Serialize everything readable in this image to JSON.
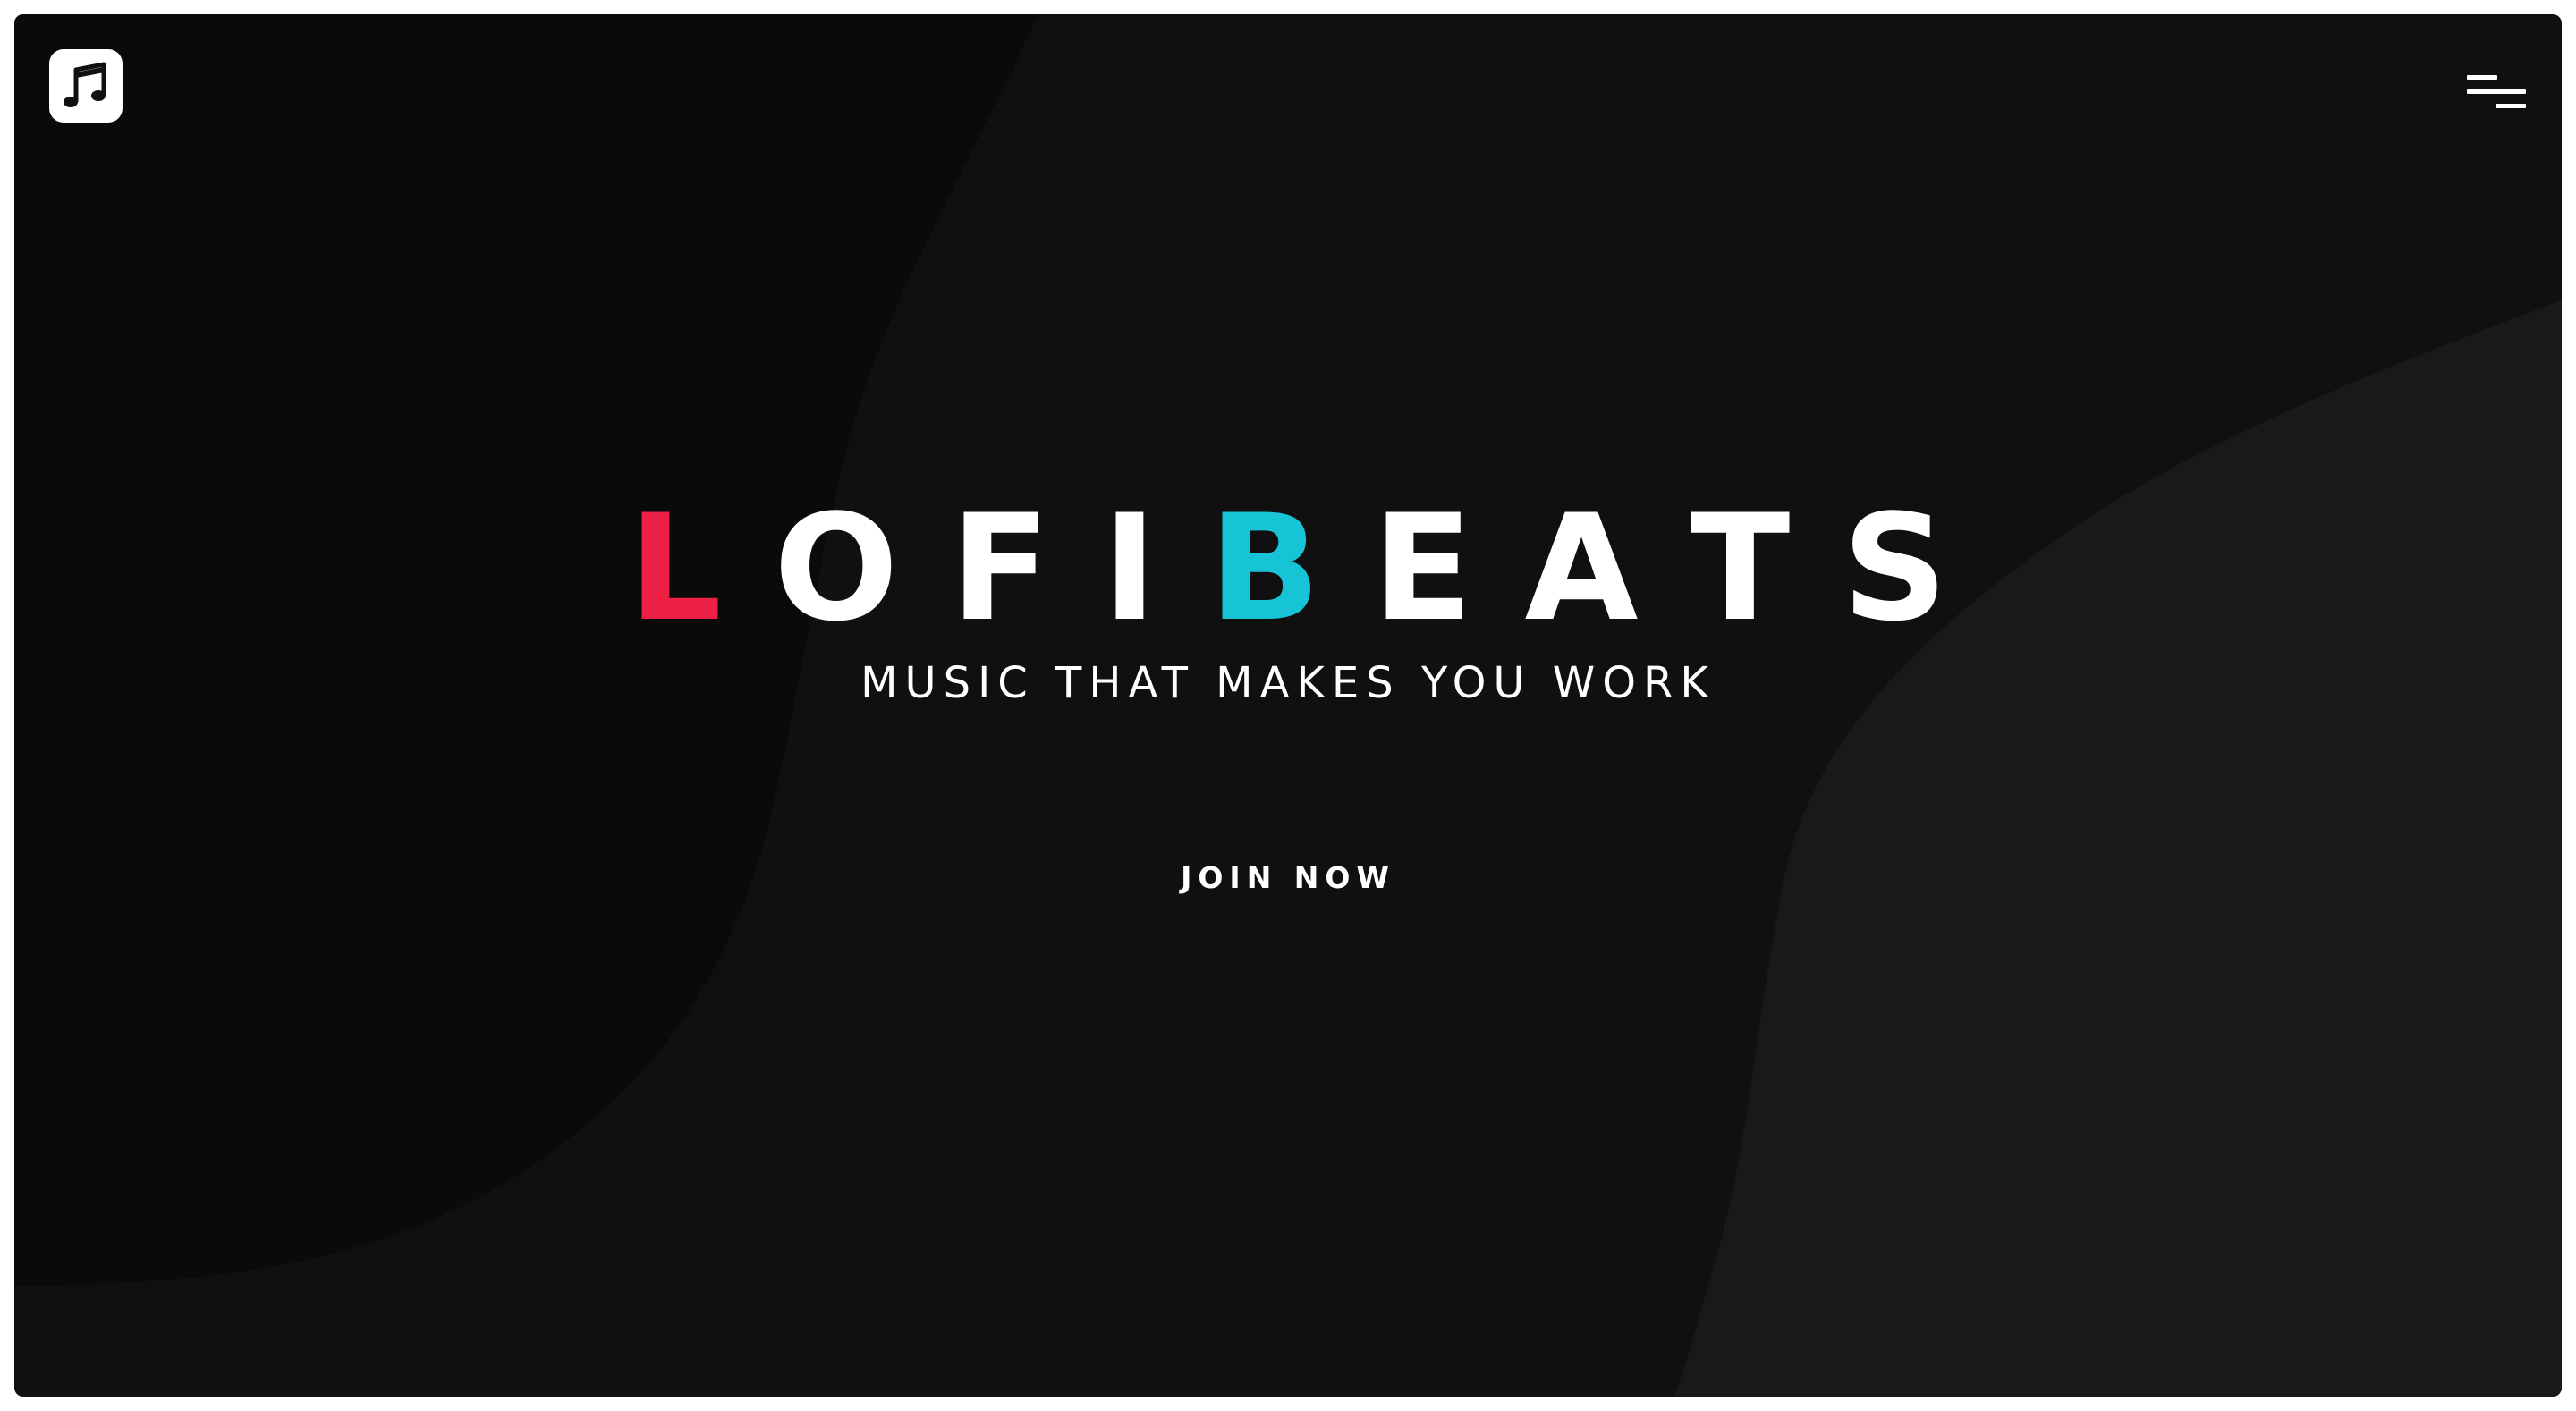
{
  "header": {
    "logo_icon": "music-note-icon",
    "menu_icon": "menu-icon"
  },
  "hero": {
    "title_letters": [
      {
        "char": "L",
        "color": "#ee1f44"
      },
      {
        "char": "O",
        "color": "#ffffff"
      },
      {
        "char": "F",
        "color": "#ffffff"
      },
      {
        "char": "I",
        "color": "#ffffff"
      },
      {
        "char": "B",
        "color": "#17c4d6"
      },
      {
        "char": "E",
        "color": "#ffffff"
      },
      {
        "char": "A",
        "color": "#ffffff"
      },
      {
        "char": "T",
        "color": "#ffffff"
      },
      {
        "char": "S",
        "color": "#ffffff"
      }
    ],
    "tagline": "MUSIC THAT MAKES YOU WORK",
    "cta_label": "JOIN NOW"
  },
  "colors": {
    "background": "#101011",
    "accent_red": "#ee1f44",
    "accent_cyan": "#17c4d6",
    "text": "#ffffff"
  }
}
